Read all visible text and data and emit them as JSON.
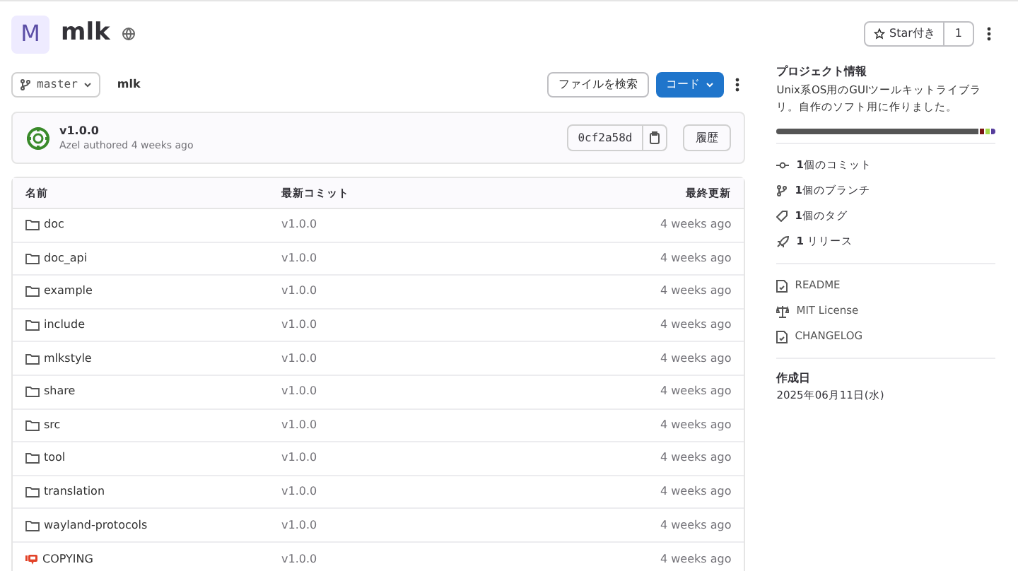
{
  "project": {
    "avatar_letter": "M",
    "name": "mlk",
    "star_label": "Star付き",
    "star_count": "1"
  },
  "repo_bar": {
    "branch": "master",
    "path": "mlk",
    "find_file": "ファイルを検索",
    "code_button": "コード"
  },
  "last_commit": {
    "title": "v1.0.0",
    "meta": "Azel authored 4 weeks ago",
    "sha": "0cf2a58d",
    "history": "履歴"
  },
  "table": {
    "columns": [
      "名前",
      "最新コミット",
      "最終更新"
    ],
    "rows": [
      {
        "kind": "folder",
        "name": "doc",
        "commit": "v1.0.0",
        "updated": "4 weeks ago"
      },
      {
        "kind": "folder",
        "name": "doc_api",
        "commit": "v1.0.0",
        "updated": "4 weeks ago"
      },
      {
        "kind": "folder",
        "name": "example",
        "commit": "v1.0.0",
        "updated": "4 weeks ago"
      },
      {
        "kind": "folder",
        "name": "include",
        "commit": "v1.0.0",
        "updated": "4 weeks ago"
      },
      {
        "kind": "folder",
        "name": "mlkstyle",
        "commit": "v1.0.0",
        "updated": "4 weeks ago"
      },
      {
        "kind": "folder",
        "name": "share",
        "commit": "v1.0.0",
        "updated": "4 weeks ago"
      },
      {
        "kind": "folder",
        "name": "src",
        "commit": "v1.0.0",
        "updated": "4 weeks ago"
      },
      {
        "kind": "folder",
        "name": "tool",
        "commit": "v1.0.0",
        "updated": "4 weeks ago"
      },
      {
        "kind": "folder",
        "name": "translation",
        "commit": "v1.0.0",
        "updated": "4 weeks ago"
      },
      {
        "kind": "folder",
        "name": "wayland-protocols",
        "commit": "v1.0.0",
        "updated": "4 weeks ago"
      },
      {
        "kind": "license",
        "name": "COPYING",
        "commit": "v1.0.0",
        "updated": "4 weeks ago"
      }
    ]
  },
  "sidebar": {
    "heading": "プロジェクト情報",
    "description": "Unix系OS用のGUIツールキットライブラリ。自作のソフト用に作りました。",
    "languages": [
      {
        "color": "#555555"
      },
      {
        "color": "#7a1515"
      },
      {
        "color": "#a6d94a"
      },
      {
        "color": "#563d9c"
      }
    ],
    "stats": [
      {
        "kind": "commit",
        "label": "**1**個のコミット"
      },
      {
        "kind": "branch",
        "label": "**1**個のブランチ"
      },
      {
        "kind": "tag",
        "label": "**1**個のタグ"
      },
      {
        "kind": "release",
        "label": "**1** リリース"
      }
    ],
    "files": [
      {
        "kind": "doc",
        "label": "README"
      },
      {
        "kind": "license",
        "label": "MIT License"
      },
      {
        "kind": "doc",
        "label": "CHANGELOG"
      }
    ],
    "created_heading": "作成日",
    "created_date": "2025年06月11日(水)"
  }
}
